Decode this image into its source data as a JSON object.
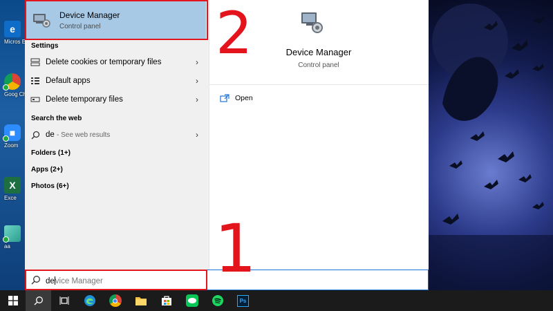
{
  "desktop": {
    "icons": [
      {
        "label": "Microsoft Edge",
        "short": "Micros Edge"
      },
      {
        "label": "Google Chrome",
        "short": "Goog Chrom"
      },
      {
        "label": "Zoom",
        "short": "Zoom"
      },
      {
        "label": "Excel",
        "short": "Exce"
      },
      {
        "label": "aa",
        "short": "aa"
      }
    ]
  },
  "best_match": {
    "title": "Device Manager",
    "subtitle": "Control panel"
  },
  "settings": {
    "header": "Settings",
    "items": [
      {
        "label": "Delete cookies or temporary files"
      },
      {
        "label": "Default apps"
      },
      {
        "label": "Delete temporary files"
      }
    ]
  },
  "web": {
    "header": "Search the web",
    "query": "de",
    "hint": "- See web results"
  },
  "groups": [
    {
      "label": "Folders (1+)"
    },
    {
      "label": "Apps (2+)"
    },
    {
      "label": "Photos (6+)"
    }
  ],
  "preview": {
    "title": "Device Manager",
    "subtitle": "Control panel",
    "action_open": "Open"
  },
  "search": {
    "typed": "de",
    "suggestion": "vice Manager"
  },
  "annotations": {
    "step1": "1",
    "step2": "2"
  },
  "colors": {
    "highlight": "#a8c9e6",
    "annotation_red": "#e3141c",
    "search_border": "#0e6ccf",
    "taskbar": "#1b1b1b"
  }
}
